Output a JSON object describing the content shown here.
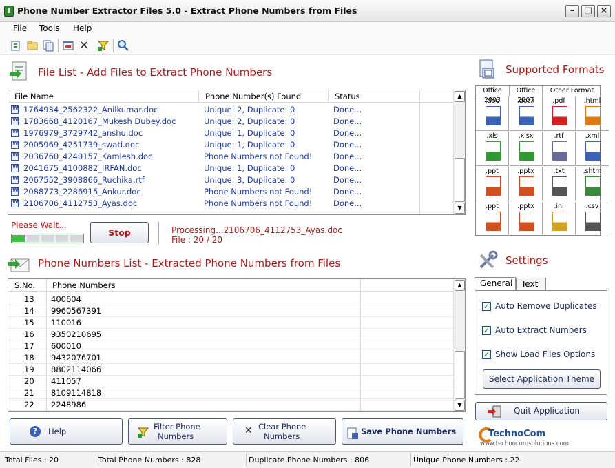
{
  "window": {
    "title": "Phone Number Extractor Files 5.0 - Extract Phone Numbers from Files"
  },
  "menu": [
    "File",
    "Tools",
    "Help"
  ],
  "file_section": {
    "heading": "File List - Add Files to Extract Phone Numbers"
  },
  "file_table": {
    "columns": [
      "File Name",
      "Phone Number(s) Found",
      "Status"
    ],
    "rows": [
      {
        "name": "1764934_2562322_Anilkumar.doc",
        "found": "Unique: 2, Duplicate: 0",
        "status": "Done..."
      },
      {
        "name": "1783668_4120167_Mukesh Dubey.doc",
        "found": "Unique: 2, Duplicate: 0",
        "status": "Done..."
      },
      {
        "name": "1976979_3729742_anshu.doc",
        "found": "Unique: 1, Duplicate: 0",
        "status": "Done..."
      },
      {
        "name": "2005969_4251739_swati.doc",
        "found": "Unique: 1, Duplicate: 0",
        "status": "Done..."
      },
      {
        "name": "2036760_4240157_Kamlesh.doc",
        "found": "Phone Numbers not Found!",
        "status": "Done..."
      },
      {
        "name": "2041675_4100882_IRFAN.doc",
        "found": "Unique: 1, Duplicate: 0",
        "status": "Done..."
      },
      {
        "name": "2067552_3908866_Ruchika.rtf",
        "found": "Unique: 3, Duplicate: 0",
        "status": "Done..."
      },
      {
        "name": "2088773_2286915_Ankur.doc",
        "found": "Phone Numbers not Found!",
        "status": "Done..."
      },
      {
        "name": "2106706_4112753_Ayas.doc",
        "found": "Phone Numbers not Found!",
        "status": "Done..."
      }
    ]
  },
  "progress": {
    "wait_label": "Please Wait...",
    "stop_label": "Stop",
    "processing_text": "Processing...2106706_4112753_Ayas.doc",
    "file_count_text": "File : 20 / 20"
  },
  "phone_section": {
    "heading": "Phone Numbers List - Extracted Phone Numbers from Files"
  },
  "phone_table": {
    "columns": [
      "S.No.",
      "Phone Numbers"
    ],
    "rows": [
      {
        "sno": "13",
        "number": "400604"
      },
      {
        "sno": "14",
        "number": "9960567391"
      },
      {
        "sno": "15",
        "number": "110016"
      },
      {
        "sno": "16",
        "number": "9350210695"
      },
      {
        "sno": "17",
        "number": "600010"
      },
      {
        "sno": "18",
        "number": "9432076701"
      },
      {
        "sno": "19",
        "number": "8802114066"
      },
      {
        "sno": "20",
        "number": "411057"
      },
      {
        "sno": "21",
        "number": "8109114818"
      },
      {
        "sno": "22",
        "number": "2248986"
      }
    ]
  },
  "buttons": {
    "help": "Help",
    "filter": [
      "Filter Phone",
      "Numbers"
    ],
    "clear": [
      "Clear Phone",
      "Numbers"
    ],
    "save": "Save Phone Numbers",
    "quit": "Quit Application",
    "theme": "Select Application Theme"
  },
  "formats": {
    "heading": "Supported Formats",
    "headers": [
      "Office 2003",
      "Office 2007",
      "Other Format"
    ],
    "cells": [
      ".doc",
      ".docx",
      ".pdf",
      ".html",
      ".xls",
      ".xlsx",
      ".rtf",
      ".xml",
      ".ppt",
      ".pptx",
      ".txt",
      ".shtm",
      ".ppt",
      ".pptx",
      ".ini",
      ".csv"
    ]
  },
  "settings": {
    "heading": "Settings",
    "tabs": [
      "General",
      "Text"
    ],
    "options": [
      {
        "label": "Auto Remove Duplicates",
        "checked": true
      },
      {
        "label": "Auto Extract Numbers",
        "checked": true
      },
      {
        "label": "Show Load Files Options",
        "checked": true
      }
    ]
  },
  "brand": {
    "name": "TechnoCom",
    "url": "www.technocomsolutions.com"
  },
  "status": {
    "total_files": "Total Files :  20",
    "total_phone": "Total Phone Numbers :   828",
    "duplicate": "Duplicate Phone Numbers :    806",
    "unique": "Unique Phone Numbers :   22"
  }
}
